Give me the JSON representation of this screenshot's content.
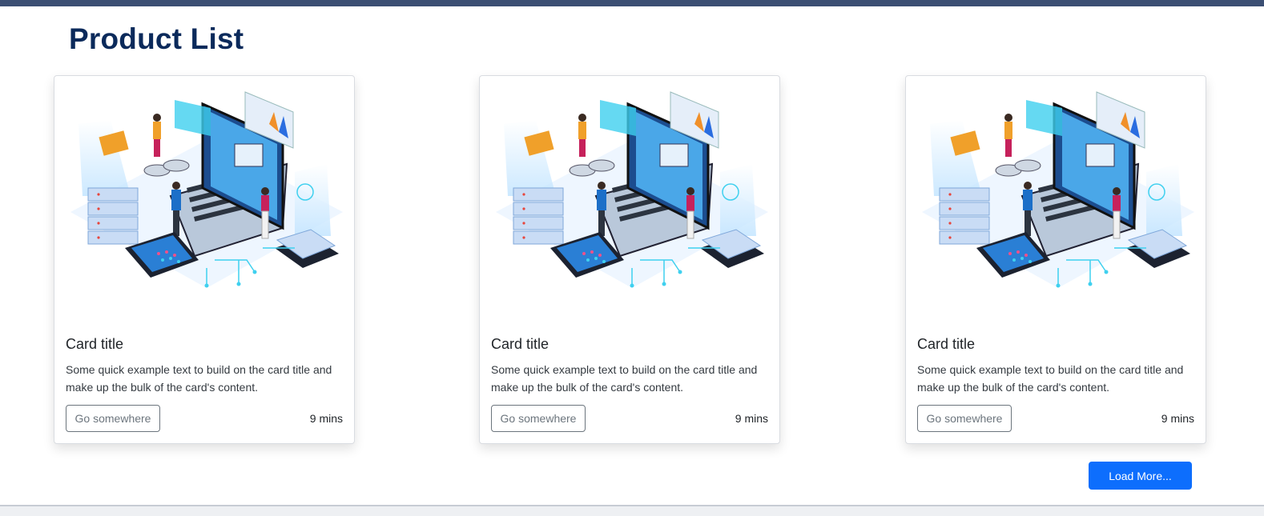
{
  "page": {
    "title": "Product List"
  },
  "cards": [
    {
      "title": "Card title",
      "text": "Some quick example text to build on the card title and make up the bulk of the card's content.",
      "button_label": "Go somewhere",
      "time": "9 mins"
    },
    {
      "title": "Card title",
      "text": "Some quick example text to build on the card title and make up the bulk of the card's content.",
      "button_label": "Go somewhere",
      "time": "9 mins"
    },
    {
      "title": "Card title",
      "text": "Some quick example text to build on the card title and make up the bulk of the card's content.",
      "button_label": "Go somewhere",
      "time": "9 mins"
    }
  ],
  "load_more_label": "Load More...",
  "colors": {
    "accent": "#0d6efd",
    "title": "#0b2a5b",
    "header_bar": "#3b4f73"
  }
}
